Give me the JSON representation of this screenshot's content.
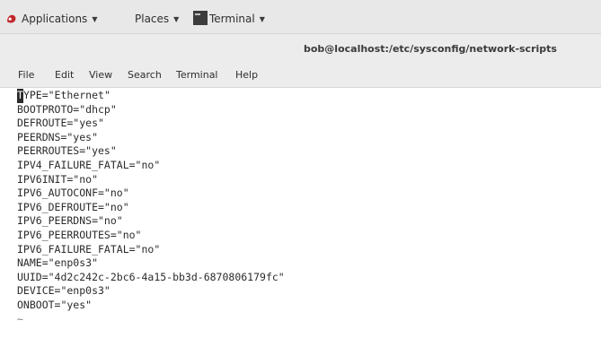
{
  "top_panel": {
    "applications_label": "Applications",
    "places_label": "Places",
    "terminal_label": "Terminal",
    "dropdown_arrow": "▼"
  },
  "window": {
    "title": "bob@localhost:/etc/sysconfig/network-scripts"
  },
  "menu": {
    "file": "File",
    "edit": "Edit",
    "view": "View",
    "search": "Search",
    "terminal": "Terminal",
    "help": "Help"
  },
  "terminal": {
    "cursor_char": "T",
    "first_line_rest": "YPE=\"Ethernet\"",
    "lines": [
      "BOOTPROTO=\"dhcp\"",
      "DEFROUTE=\"yes\"",
      "PEERDNS=\"yes\"",
      "PEERROUTES=\"yes\"",
      "IPV4_FAILURE_FATAL=\"no\"",
      "IPV6INIT=\"no\"",
      "IPV6_AUTOCONF=\"no\"",
      "IPV6_DEFROUTE=\"no\"",
      "IPV6_PEERDNS=\"no\"",
      "IPV6_PEERROUTES=\"no\"",
      "IPV6_FAILURE_FATAL=\"no\"",
      "NAME=\"enp0s3\"",
      "UUID=\"4d2c242c-2bc6-4a15-bb3d-6870806179fc\"",
      "DEVICE=\"enp0s3\"",
      "ONBOOT=\"yes\""
    ],
    "empty_line_marker": "~"
  },
  "colors": {
    "panel_bg": "#e8e8e8",
    "menu_bg": "#ececec",
    "terminal_bg": "#ffffff",
    "terminal_text": "#2b2b2b",
    "logo_red": "#c0282d"
  }
}
